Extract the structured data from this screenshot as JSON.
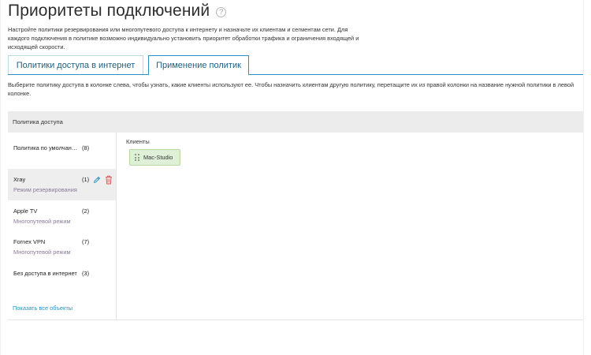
{
  "page": {
    "title": "Приоритеты подключений",
    "help_icon": "?",
    "description": "Настройте политики резервирования или многопутевого доступа к интернету и назначьте их клиентам и сегментам сети. Для каждого подключения в политике возможно индивидуально установить приоритет обработки трафика и ограничения входящей и исходящей скорости."
  },
  "tabs": [
    {
      "label": "Политики доступа в интернет",
      "active": false
    },
    {
      "label": "Применение политик",
      "active": true
    }
  ],
  "instructions": "Выберите политику доступа в колонке слева, чтобы узнать, какие клиенты используют ее. Чтобы назначить клиентам другую политику, перетащите их из правой колонки на название нужной политики в левой колонке.",
  "panel": {
    "header": "Политика доступа",
    "policies": [
      {
        "name": "Политика по умолчан…",
        "count": "(8)",
        "mode": ""
      },
      {
        "name": "Xray",
        "count": "(1)",
        "mode": "Режим резервирования",
        "selected": true
      },
      {
        "name": "Apple TV",
        "count": "(2)",
        "mode": "Многопутевой режим"
      },
      {
        "name": "Fornex VPN",
        "count": "(7)",
        "mode": "Многопутевой режим"
      },
      {
        "name": "Без доступа в интернет",
        "count": "(3)",
        "mode": ""
      }
    ],
    "show_all": "Показать все объекты",
    "icons": {
      "edit": "pencil-icon",
      "delete": "trash-icon"
    }
  },
  "clients": {
    "label": "Клиенты",
    "items": [
      {
        "name": "Mac-Studio"
      }
    ]
  },
  "colors": {
    "accent": "#2a8fc1",
    "selected_row": "#eeeeee",
    "client_chip": "#dff0d8",
    "delete": "#e05050"
  }
}
